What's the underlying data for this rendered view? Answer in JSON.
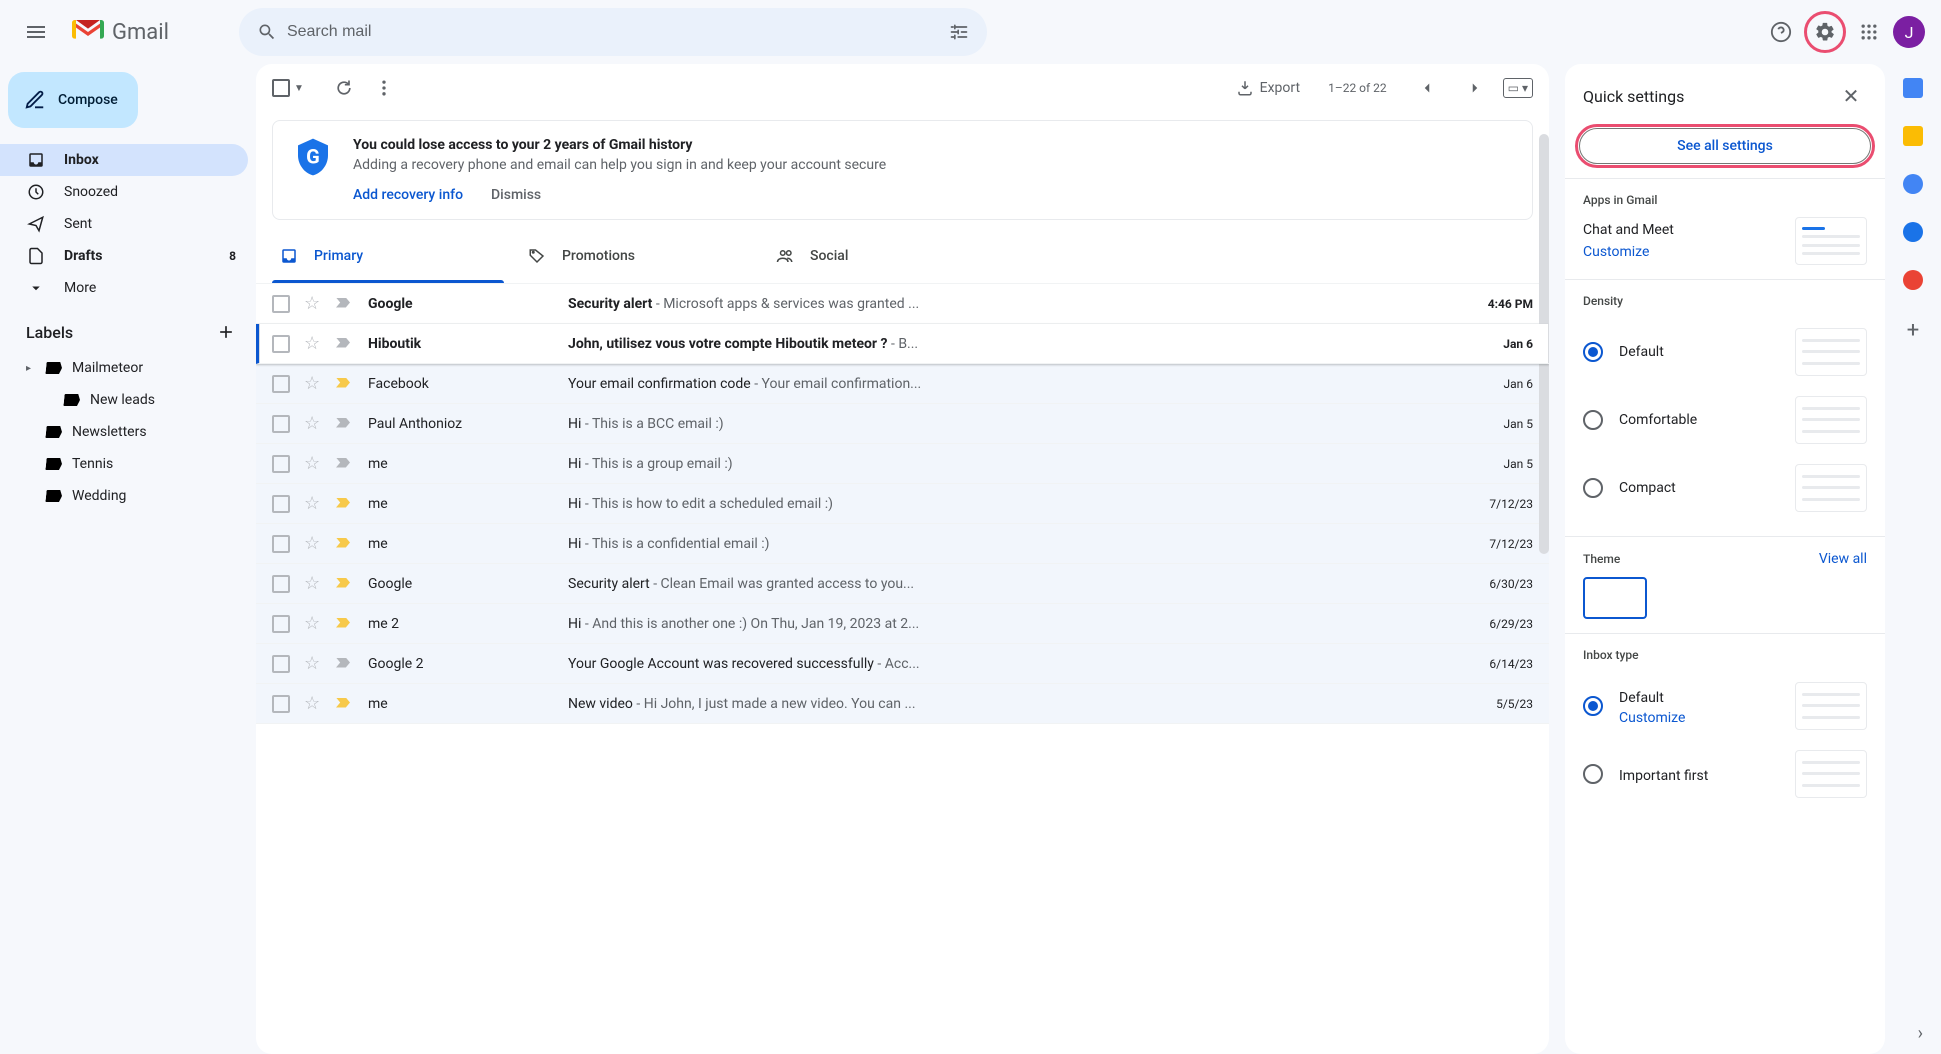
{
  "header": {
    "app_name": "Gmail",
    "search_placeholder": "Search mail",
    "avatar_initial": "J"
  },
  "sidebar": {
    "compose": "Compose",
    "nav": [
      {
        "icon": "inbox",
        "label": "Inbox",
        "active": true,
        "bold": true,
        "count": ""
      },
      {
        "icon": "clock",
        "label": "Snoozed"
      },
      {
        "icon": "send",
        "label": "Sent"
      },
      {
        "icon": "doc",
        "label": "Drafts",
        "bold": true,
        "count": "8"
      },
      {
        "icon": "more",
        "label": "More"
      }
    ],
    "labels_title": "Labels",
    "labels": [
      {
        "label": "Mailmeteor",
        "has_children": true
      },
      {
        "label": "New leads",
        "nested": true
      },
      {
        "label": "Newsletters"
      },
      {
        "label": "Tennis"
      },
      {
        "label": "Wedding"
      }
    ]
  },
  "toolbar": {
    "export_label": "Export",
    "page_info": "1–22 of 22"
  },
  "recovery": {
    "title": "You could lose access to your 2 years of Gmail history",
    "subtitle": "Adding a recovery phone and email can help you sign in and keep your account secure",
    "add": "Add recovery info",
    "dismiss": "Dismiss"
  },
  "tabs": [
    {
      "label": "Primary",
      "active": true,
      "icon": "primary"
    },
    {
      "label": "Promotions",
      "icon": "promo"
    },
    {
      "label": "Social",
      "icon": "social"
    }
  ],
  "emails": [
    {
      "sender": "Google",
      "subject": "Security alert",
      "snippet": " - Microsoft apps & services was granted ...",
      "date": "4:46 PM",
      "unread": true,
      "important": false
    },
    {
      "sender": "Hiboutik",
      "subject": "John, utilisez vous votre compte Hiboutik meteor ?",
      "snippet": " - B...",
      "date": "Jan 6",
      "unread": true,
      "important": false,
      "hover": true
    },
    {
      "sender": "Facebook",
      "subject": "Your email confirmation code",
      "snippet": " - Your email confirmation...",
      "date": "Jan 6",
      "unread": false,
      "important": true
    },
    {
      "sender": "Paul Anthonioz",
      "subject": "Hi",
      "snippet": " - This is a BCC email :)",
      "date": "Jan 5",
      "unread": false,
      "important": false
    },
    {
      "sender": "me",
      "subject": "Hi",
      "snippet": " - This is a group email :)",
      "date": "Jan 5",
      "unread": false,
      "important": false
    },
    {
      "sender": "me",
      "subject": "Hi",
      "snippet": " - This is how to edit a scheduled email :)",
      "date": "7/12/23",
      "unread": false,
      "important": true
    },
    {
      "sender": "me",
      "subject": "Hi",
      "snippet": " - This is a confidential email :)",
      "date": "7/12/23",
      "unread": false,
      "important": true
    },
    {
      "sender": "Google",
      "subject": "Security alert",
      "snippet": " - Clean Email was granted access to you...",
      "date": "6/30/23",
      "unread": false,
      "important": true
    },
    {
      "sender": "me 2",
      "subject": "Hi",
      "snippet": " - And this is another one :) On Thu, Jan 19, 2023 at 2...",
      "date": "6/29/23",
      "unread": false,
      "important": true
    },
    {
      "sender": "Google 2",
      "subject": "Your Google Account was recovered successfully",
      "snippet": " - Acc...",
      "date": "6/14/23",
      "unread": false,
      "important": false
    },
    {
      "sender": "me",
      "subject": "New video",
      "snippet": " - Hi John, I just made a new video. You can ...",
      "date": "5/5/23",
      "unread": false,
      "important": true
    }
  ],
  "quick_settings": {
    "title": "Quick settings",
    "see_all": "See all settings",
    "apps_title": "Apps in Gmail",
    "chat_meet": "Chat and Meet",
    "customize": "Customize",
    "density_title": "Density",
    "density": [
      {
        "label": "Default",
        "checked": true
      },
      {
        "label": "Comfortable",
        "checked": false
      },
      {
        "label": "Compact",
        "checked": false
      }
    ],
    "theme_title": "Theme",
    "view_all": "View all",
    "inbox_type_title": "Inbox type",
    "inbox_types": [
      {
        "label": "Default",
        "sub": "Customize",
        "checked": true
      },
      {
        "label": "Important first",
        "checked": false
      }
    ]
  }
}
